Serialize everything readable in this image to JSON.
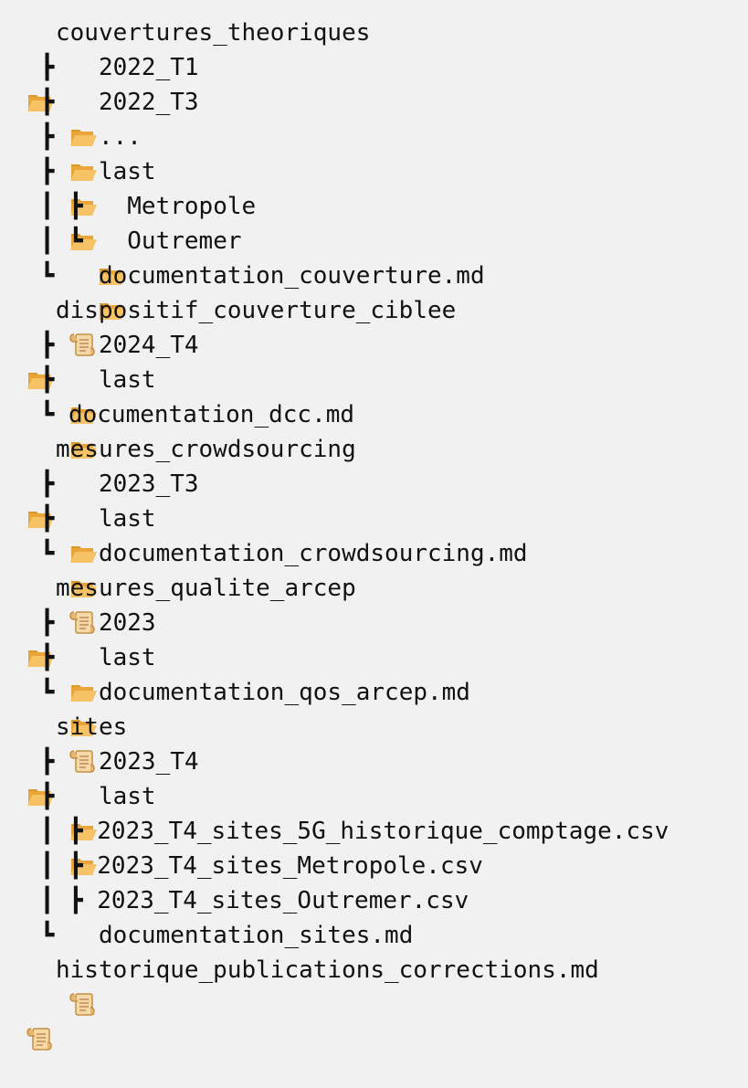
{
  "tree": [
    {
      "prefix": "",
      "icon": "folder-icon",
      "label": "couvertures_theoriques"
    },
    {
      "prefix": " ┣ ",
      "icon": "folder-icon",
      "label": "2022_T1"
    },
    {
      "prefix": " ┣ ",
      "icon": "folder-icon",
      "label": "2022_T3"
    },
    {
      "prefix": " ┣ ",
      "icon": "folder-icon",
      "label": "..."
    },
    {
      "prefix": " ┣ ",
      "icon": "folder-icon",
      "label": "last"
    },
    {
      "prefix": " ┃ ┣ ",
      "icon": "folder-icon",
      "label": "Metropole"
    },
    {
      "prefix": " ┃ ┗ ",
      "icon": "folder-icon",
      "label": "Outremer"
    },
    {
      "prefix": " ┗ ",
      "icon": "scroll-icon",
      "label": "documentation_couverture.md"
    },
    {
      "prefix": "",
      "icon": "folder-icon",
      "label": "dispositif_couverture_ciblee"
    },
    {
      "prefix": " ┣ ",
      "icon": "folder-icon",
      "label": "2024_T4"
    },
    {
      "prefix": " ┣ ",
      "icon": "folder-icon",
      "label": "last"
    },
    {
      "prefix": " ┗ ",
      "icon": "",
      "label": "documentation_dcc.md"
    },
    {
      "prefix": "",
      "icon": "folder-icon",
      "label": "mesures_crowdsourcing"
    },
    {
      "prefix": " ┣ ",
      "icon": "folder-icon",
      "label": "2023_T3"
    },
    {
      "prefix": " ┣ ",
      "icon": "folder-icon",
      "label": "last"
    },
    {
      "prefix": " ┗ ",
      "icon": "scroll-icon",
      "label": "documentation_crowdsourcing.md"
    },
    {
      "prefix": "",
      "icon": "folder-icon",
      "label": "mesures_qualite_arcep"
    },
    {
      "prefix": " ┣ ",
      "icon": "folder-icon",
      "label": "2023"
    },
    {
      "prefix": " ┣ ",
      "icon": "folder-icon",
      "label": "last"
    },
    {
      "prefix": " ┗ ",
      "icon": "scroll-icon",
      "label": "documentation_qos_arcep.md"
    },
    {
      "prefix": "",
      "icon": "folder-icon",
      "label": "sites"
    },
    {
      "prefix": " ┣ ",
      "icon": "folder-icon",
      "label": "2023_T4"
    },
    {
      "prefix": " ┣ ",
      "icon": "folder-icon",
      "label": "last"
    },
    {
      "prefix": " ┃ ┣ ",
      "icon": "",
      "label": "2023_T4_sites_5G_historique_comptage.csv"
    },
    {
      "prefix": " ┃ ┣ ",
      "icon": "",
      "label": "2023_T4_sites_Metropole.csv"
    },
    {
      "prefix": " ┃ ┣ ",
      "icon": "",
      "label": "2023_T4_sites_Outremer.csv"
    },
    {
      "prefix": " ┗ ",
      "icon": "scroll-icon",
      "label": "documentation_sites.md"
    },
    {
      "prefix": "",
      "icon": "scroll-icon",
      "label": "historique_publications_corrections.md"
    }
  ]
}
